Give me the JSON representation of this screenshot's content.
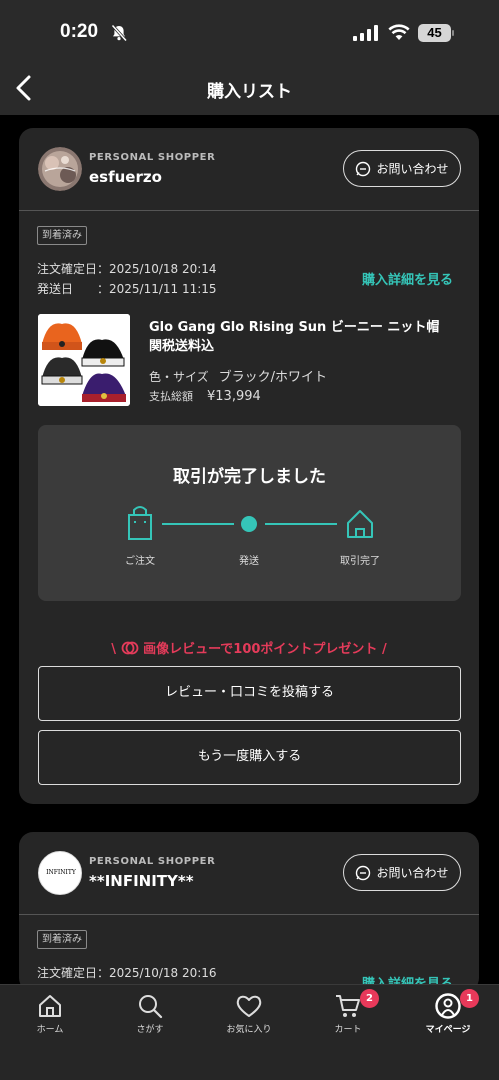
{
  "status_bar": {
    "time": "0:20",
    "battery": "45"
  },
  "nav": {
    "title": "購入リスト"
  },
  "orders": [
    {
      "shopper_label": "PERSONAL SHOPPER",
      "shopper_name": "esfuerzo",
      "contact_label": "お問い合わせ",
      "status_badge": "到着済み",
      "order_date_label": "注文確定日：",
      "order_date": "2025/10/18 20:14",
      "ship_date_label": "発送日　　：",
      "ship_date": "2025/11/11 11:15",
      "detail_link": "購入詳細を見る",
      "product": {
        "name": "Glo Gang Glo Rising Sun ビーニー ニット帽 関税送料込",
        "attr_label": "色・サイズ",
        "attr_value": "ブラック/ホワイト",
        "price_label": "支払総額",
        "price": "¥13,994"
      },
      "progress": {
        "title": "取引が完了しました",
        "steps": [
          "ご注文",
          "発送",
          "取引完了"
        ]
      },
      "promo": "画像レビューで100ポイントプレゼント",
      "review_button": "レビュー・口コミを投稿する",
      "rebuy_button": "もう一度購入する"
    },
    {
      "shopper_label": "PERSONAL SHOPPER",
      "shopper_name": "**INFINITY**",
      "avatar_text": "INFINITY",
      "contact_label": "お問い合わせ",
      "status_badge": "到着済み",
      "order_date_label": "注文確定日：",
      "order_date": "2025/10/18 20:16",
      "detail_link": "購入詳細を見る"
    }
  ],
  "tabs": [
    {
      "label": "ホーム",
      "icon": "home-icon"
    },
    {
      "label": "さがす",
      "icon": "search-icon"
    },
    {
      "label": "お気に入り",
      "icon": "heart-icon"
    },
    {
      "label": "カート",
      "icon": "cart-icon",
      "badge": "2"
    },
    {
      "label": "マイページ",
      "icon": "mypage-icon",
      "badge": "1",
      "active": true
    }
  ],
  "colors": {
    "accent": "#35c5b8",
    "promo": "#e43b5a",
    "badge": "#e8395a"
  }
}
